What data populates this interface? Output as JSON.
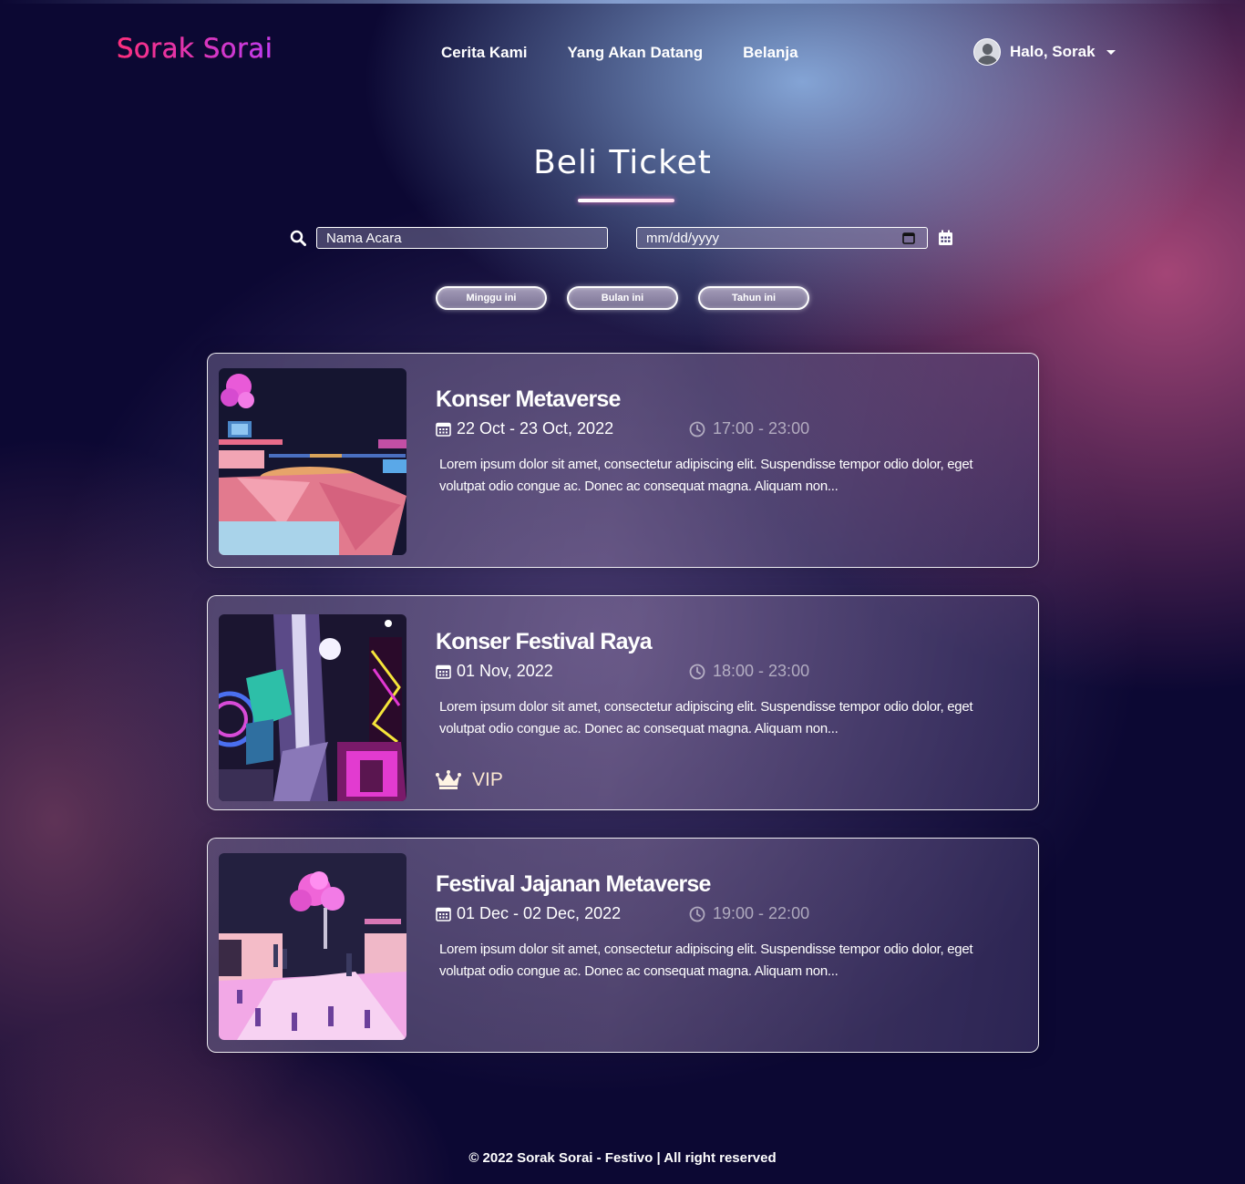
{
  "brand": {
    "logo": "Sorak Sorai",
    "colors": [
      "#ff2d7a",
      "#b23cff"
    ]
  },
  "nav": {
    "items": [
      "Cerita Kami",
      "Yang Akan Datang",
      "Belanja"
    ],
    "user_label": "Halo, Sorak"
  },
  "page": {
    "title": "Beli Ticket"
  },
  "search": {
    "name_placeholder": "Nama Acara",
    "date_placeholder": "mm/dd/yyyy",
    "icons": [
      "search-icon",
      "calendar-icon"
    ]
  },
  "filters": [
    "Minggu ini",
    "Bulan ini",
    "Tahun ini"
  ],
  "events": [
    {
      "title": "Konser Metaverse",
      "date": "22 Oct - 23 Oct, 2022",
      "time": "17:00 - 23:00",
      "description": "Lorem ipsum dolor sit amet, consectetur adipiscing elit. Suspendisse tempor odio dolor, eget volutpat odio congue ac. Donec ac consequat magna. Aliquam non...",
      "vip": ""
    },
    {
      "title": "Konser Festival Raya",
      "date": "01 Nov, 2022",
      "time": "18:00 - 23:00",
      "description": "Lorem ipsum dolor sit amet, consectetur adipiscing elit. Suspendisse tempor odio dolor, eget volutpat odio congue ac. Donec ac consequat magna. Aliquam non...",
      "vip": "VIP"
    },
    {
      "title": "Festival Jajanan Metaverse",
      "date": "01 Dec - 02 Dec, 2022",
      "time": "19:00 - 22:00",
      "description": "Lorem ipsum dolor sit amet, consectetur adipiscing elit. Suspendisse tempor odio dolor, eget volutpat odio congue ac. Donec ac consequat magna. Aliquam non...",
      "vip": ""
    }
  ],
  "footer": {
    "text": "© 2022 Sorak Sorai - Festivo | All right reserved"
  }
}
